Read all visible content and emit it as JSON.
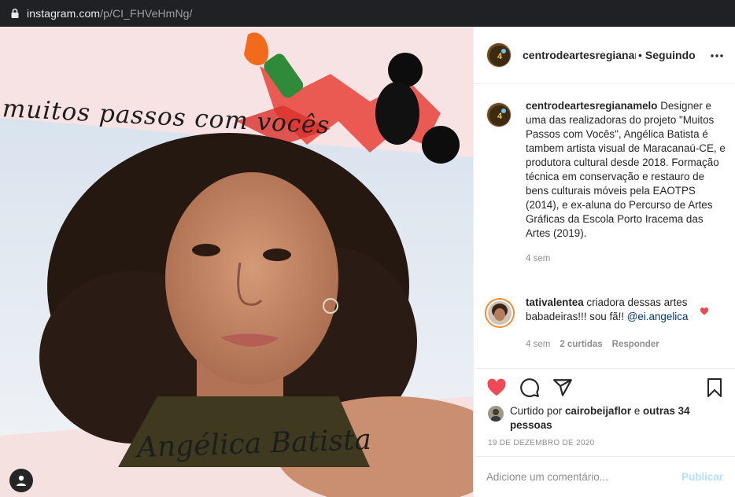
{
  "browser": {
    "url_host": "instagram.com",
    "url_path": "/p/CI_FHVeHmNg/"
  },
  "post": {
    "image_headline": "muitos passos com vocês",
    "image_signature": "Angélica Batista",
    "header": {
      "username": "centrodeartesregianam",
      "separator": "•",
      "follow_state": "Seguindo"
    },
    "caption": {
      "username": "centrodeartesregianamelo",
      "text": "Designer e uma das realizadoras do projeto \"Muitos Passos com Vocês\", Angélica Batista é tambem artista visual de Maracanaú-CE, e produtora cultural desde 2018. Formação técnica em conservação e restauro de bens culturais móveis pela EAOTPS (2014), e ex-aluna do Percurso de Artes Gráficas da Escola Porto Iracema das Artes (2019).",
      "time": "4 sem"
    },
    "comment": {
      "username": "tativalentea",
      "text": "criadora dessas artes babadeiras!!! sou fã!!",
      "mention": "@ei.angelica",
      "time": "4 sem",
      "likes": "2 curtidas",
      "reply": "Responder"
    },
    "likes": {
      "prefix": "Curtido por",
      "liker": "cairobeijaflor",
      "connector": "e",
      "others": "outras 34 pessoas"
    },
    "date": "19 DE DEZEMBRO DE 2020",
    "comment_box": {
      "placeholder": "Adicione um comentário...",
      "publish_label": "Publicar"
    }
  },
  "colors": {
    "like_red": "#ed4956",
    "publish_disabled": "#b2dffc",
    "mention_blue": "#00376b"
  },
  "icons": [
    "lock-icon",
    "more-options-icon",
    "heart-icon",
    "comment-icon",
    "share-icon",
    "bookmark-icon",
    "profile-icon"
  ]
}
